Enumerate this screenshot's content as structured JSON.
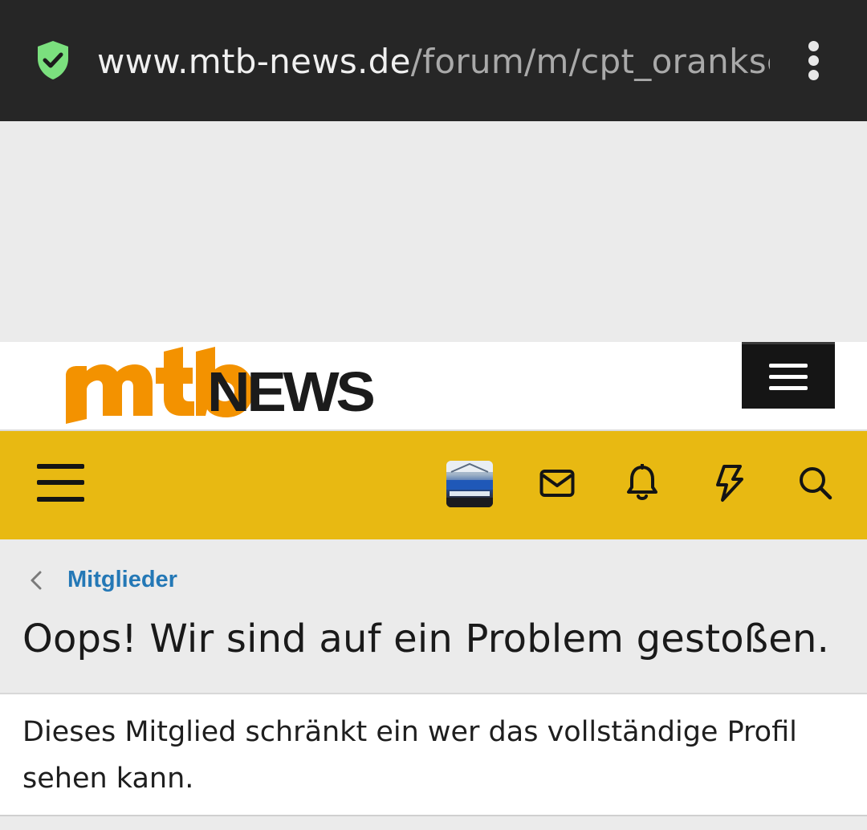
{
  "browser": {
    "url_domain": "www.mtb-news.de",
    "url_path": "/forum/m/cpt_orankscht",
    "secure_icon": "shield-check-icon",
    "menu_icon": "kebab-menu-icon"
  },
  "site": {
    "logo_mtb": "mtb",
    "logo_news": "NEWS",
    "brand_orange": "#f39200",
    "brand_yellow": "#e8b912"
  },
  "nav": {
    "icons": [
      "hamburger-icon",
      "avatar",
      "envelope-icon",
      "bell-icon",
      "lightning-icon",
      "search-icon"
    ]
  },
  "breadcrumb": {
    "label": "Mitglieder"
  },
  "page": {
    "title": "Oops! Wir sind auf ein Problem gestoßen.",
    "message": "Dieses Mitglied schränkt ein wer das vollständige Profil sehen kann."
  }
}
